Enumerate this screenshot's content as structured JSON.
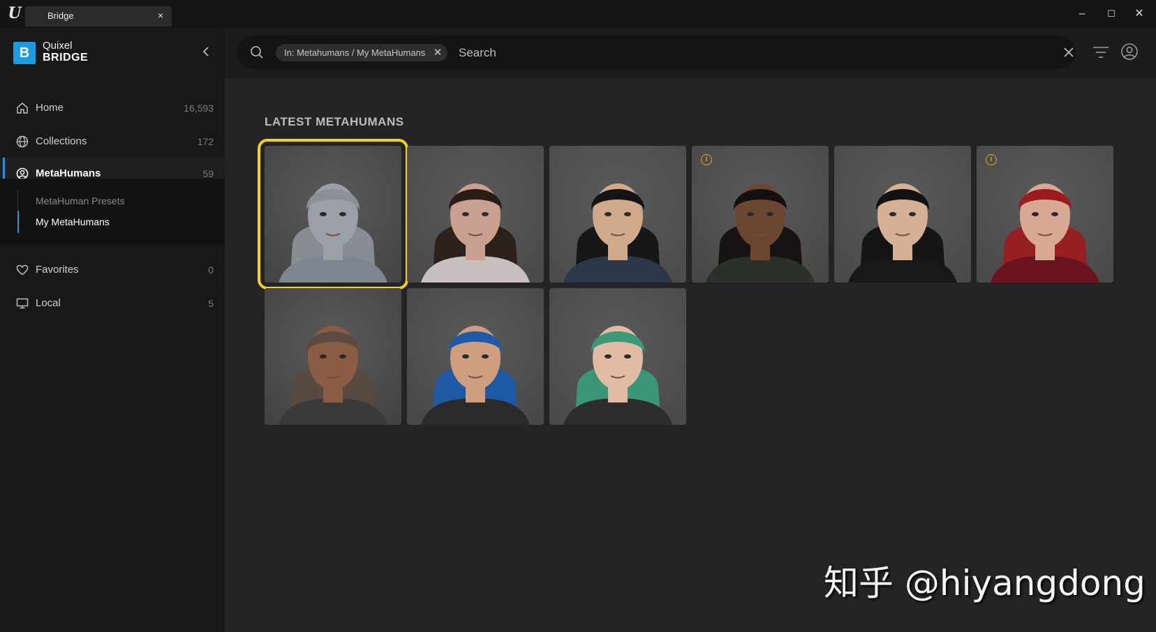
{
  "window": {
    "tab_title": "Bridge",
    "tab_close": "×",
    "minimize": "–",
    "maximize": "☐",
    "close": "✕"
  },
  "sidebar": {
    "brand_line1": "Quixel",
    "brand_line2": "BRIDGE",
    "brand_mark": "B",
    "items": [
      {
        "label": "Home",
        "count": "16,593",
        "icon": "home-icon"
      },
      {
        "label": "Collections",
        "count": "172",
        "icon": "globe-icon"
      },
      {
        "label": "MetaHumans",
        "count": "59",
        "icon": "person-circle-icon",
        "active": true
      },
      {
        "label": "Favorites",
        "count": "0",
        "icon": "heart-icon"
      },
      {
        "label": "Local",
        "count": "5",
        "icon": "monitor-icon"
      }
    ],
    "subitems": [
      {
        "label": "MetaHuman Presets",
        "active": false
      },
      {
        "label": "My MetaHumans",
        "active": true
      }
    ]
  },
  "search": {
    "chip_label": "In: Metahumans / My MetaHumans",
    "chip_close": "✕",
    "placeholder": "Search"
  },
  "main": {
    "section_title": "LATEST METAHUMANS",
    "cards": [
      {
        "name": "bald-grey-skin",
        "selected": true,
        "info": false,
        "skin": "#9aa0a5",
        "hair": "#8a9096",
        "shirt": "#7d8690",
        "bg": "#454545"
      },
      {
        "name": "woman-dark-hair-bun",
        "selected": false,
        "info": false,
        "skin": "#c9a090",
        "hair": "#2a1d18",
        "shirt": "#c8c0c0",
        "bg": "#4a4a4a"
      },
      {
        "name": "man-short-black-hair",
        "selected": false,
        "info": false,
        "skin": "#d0a88a",
        "hair": "#141414",
        "shirt": "#2c3848",
        "bg": "#4c4c4c"
      },
      {
        "name": "woman-dark-skin",
        "selected": false,
        "info": true,
        "skin": "#6b4630",
        "hair": "#141010",
        "shirt": "#2b3028",
        "bg": "#484848"
      },
      {
        "name": "man-black-hair",
        "selected": false,
        "info": false,
        "skin": "#d5b095",
        "hair": "#121212",
        "shirt": "#181818",
        "bg": "#4a4a4a"
      },
      {
        "name": "woman-red-hair",
        "selected": false,
        "info": true,
        "skin": "#d8a894",
        "hair": "#9a1c20",
        "shirt": "#6a1420",
        "bg": "#4a4a4a"
      },
      {
        "name": "older-man-bald",
        "selected": false,
        "info": false,
        "skin": "#8a5c44",
        "hair": "#5a4a40",
        "shirt": "#3a3a3a",
        "bg": "#444444"
      },
      {
        "name": "woman-blue-hair",
        "selected": false,
        "info": false,
        "skin": "#cf9e80",
        "hair": "#1e5aa8",
        "shirt": "#2a2a2a",
        "bg": "#484848"
      },
      {
        "name": "woman-green-purple-hair",
        "selected": false,
        "info": false,
        "skin": "#e2bba5",
        "hair": "#3a9a78",
        "shirt": "#2c2c2c",
        "bg": "#4a4a4a"
      }
    ]
  },
  "watermark": "知乎 @hiyangdong",
  "colors": {
    "accent": "#2b8fd8",
    "selection": "#f3d02a",
    "warning": "#e8a51c"
  }
}
